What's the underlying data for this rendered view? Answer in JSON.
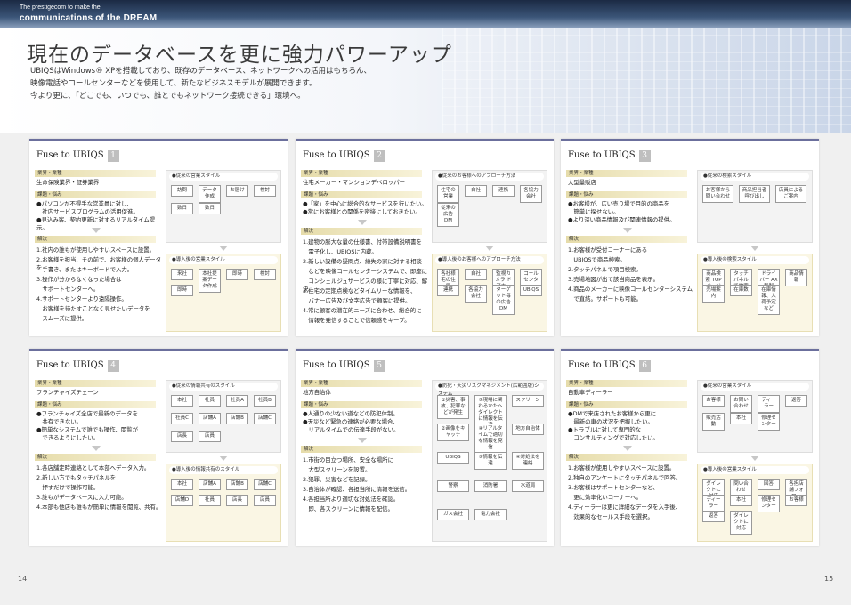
{
  "header": {
    "line1": "The prestigecom to make the",
    "line2": "communications of the DREAM"
  },
  "title": "現在のデータベースを更に強力パワーアップ",
  "lead": [
    "UBIQSはWindows® XPを搭載しており、既存のデータベース、ネットワークへの活用はもちろん、",
    "映像電話やコールセンターなどを使用して、新たなビジネスモデルが展開できます。",
    "今より更に、「どこでも、いつでも、誰とでもネットワーク接続できる」環境へ。"
  ],
  "common": {
    "fuse": "Fuse to UBIQS",
    "industry": "業界・業種",
    "issue": "課題・悩み",
    "solution": "解決"
  },
  "panels": [
    {
      "num": "1",
      "industry": "生命保険業界・証券業界",
      "issues": [
        "●パソコンが不得手な営業員に対し、",
        "　社内サービスプログラムの活用促進。",
        "●見込み客、契約更新に対するリアルタイム提示。"
      ],
      "solutions": [
        "1.社内の誰もが使用しやすいスペースに設置。",
        "2.お客様を担当、その前で、お客様の個人データを",
        "　手書き、またはキーボードで入力。",
        "3.操作が分からなくなった場合は",
        "　サポートセンターへ。",
        "4.サポートセンターより遠隔操作。",
        "　お客様を待たすことなく見せたいデータを",
        "　スムーズに提供。"
      ],
      "d1": {
        "title": "●従来の営業スタイル",
        "items": [
          "訪問",
          "データ作成",
          "お届け",
          "検討",
          "数日",
          "数日"
        ]
      },
      "d2": {
        "title": "●導入後の営業スタイル",
        "items": [
          "来社",
          "本社提案データ作成",
          "即時",
          "検討",
          "即時"
        ]
      }
    },
    {
      "num": "2",
      "industry": "住宅メーカー・マンションデベロッパー",
      "issues": [
        "●「家」を中心に総合的なサービスを行いたい。",
        "●常にお客様との関係を密接にしておきたい。"
      ],
      "solutions": [
        "1.建物の膨大な量の仕様書、付帯設備説明書を",
        "　電子化し、UBIQSに内蔵。",
        "2.新しい設備の疑問点、紛失の家に対する相談",
        "　などを映像コールセンターシステムで、即座に",
        "　コンシェルジュサービスの様に丁寧に対応、解決。",
        "3.住宅の定期点検などタイムリーな情報を、",
        "　バナー広告及び文字広告で顧客に提供。",
        "4.常に顧客の潜在的ニーズに合わせ、総合的に",
        "　情報を発信することで信頼感をキープ。"
      ],
      "d1": {
        "title": "●従来のお客様へのアプローチ方法",
        "items": [
          "住宅の営業",
          "自社",
          "連携",
          "各協力会社",
          "従来の広告 DM"
        ]
      },
      "d2": {
        "title": "●導入後のお客様へのアプローチ方法",
        "items": [
          "各社様宅の住居",
          "自社",
          "監視カメラ ドアホーン",
          "コールセンター",
          "連携",
          "各協力会社",
          "ターゲット毎の広告 DM",
          "UBIQS"
        ]
      }
    },
    {
      "num": "3",
      "industry": "大型量販店",
      "issues": [
        "●お客様が、広い売り場で目的の商品を",
        "　簡単に探せない。",
        "●より深い商品情報及び関連情報の提供。"
      ],
      "solutions": [
        "1.お客様が受付コーナーにある",
        "　UBIQSで商品検索。",
        "2.タッチパネルで項目検索。",
        "3.売場地図が出て該当商品を表示。",
        "4.商品のメーカーに映像コールセンターシステム",
        "　で直結。サポートも可能。"
      ],
      "d1": {
        "title": "●従来の検索スタイル",
        "items": [
          "お客様から問い合わせ",
          "商品担当者呼び出し",
          "店員による ご案内"
        ]
      },
      "d2": {
        "title": "●導入後の検索スタイル",
        "items": [
          "商品検索 TOPページ",
          "タッチパネルで検索",
          "ドライバー AX型製 TH-01",
          "商品情報",
          "売場案内",
          "在庫数",
          "在庫情報、入荷予定 など"
        ]
      }
    },
    {
      "num": "4",
      "industry": "フランチャイズチェーン",
      "issues": [
        "●フランチャイズ全店で最新のデータを",
        "　共有できない。",
        "●簡単なシステムで誰でも操作、閲覧が",
        "　できるようにしたい。"
      ],
      "solutions": [
        "1.各店舗定時連絡として本部へデータ入力。",
        "2.新しい方でもタッチパネルを",
        "　押すだけで操作可能。",
        "3.誰もがデータベースに入力可能。",
        "4.本部も他店も誰もが簡単に情報を閲覧、共有。"
      ],
      "d1": {
        "title": "●従来の情報共有のスタイル",
        "items": [
          "本社",
          "社員",
          "社員A",
          "社員B",
          "社員C",
          "店舗A",
          "店舗B",
          "店舗C",
          "店長",
          "店員"
        ]
      },
      "d2": {
        "title": "●導入後の情報共有のスタイル",
        "items": [
          "本社",
          "店舗A",
          "店舗B",
          "店舗C",
          "店舗D",
          "社員",
          "店長",
          "店員"
        ]
      }
    },
    {
      "num": "5",
      "industry": "地方自治体",
      "issues": [
        "●人通りの少ない道などの防犯体制。",
        "●天災など緊急の連絡が必要な場合、",
        "　リアルタイムでの伝達手段がない。"
      ],
      "solutions": [
        "1.市街の目立つ場所、安全な場所に",
        "　大型スクリーンを設置。",
        "2.犯罪、災害などを記録。",
        "3.自治体が確認、各担当所に情報を送信。",
        "4.各担当所より適切な対処法を確認。",
        "　即、各スクリーンに情報を配信。"
      ],
      "d1": {
        "title": "●防犯・天災リスクマネジメント(広範囲版)システム",
        "items": [
          "①災害、事故、犯罪などが発生",
          "⑤現場に関わるかたへダイレクトに情報を伝達",
          "スクリーン",
          "②画像をキャッチ",
          "④リアルタイムで適切な情報を発信",
          "地方自治体",
          "UBIQS",
          "③情報を伝達",
          "④対処法を連絡",
          "警察",
          "消防署",
          "水道局",
          "ガス会社",
          "電力会社"
        ]
      },
      "d2": {
        "title": "",
        "items": []
      }
    },
    {
      "num": "6",
      "industry": "自動車ディーラー",
      "issues": [
        "●DMで来店されたお客様から更に",
        "　最新の車の状況を把握したい。",
        "●トラブルに対して専門的な",
        "　コンサルティングで対応したい。"
      ],
      "solutions": [
        "1.お客様が使用しやすいスペースに設置。",
        "2.独自のアンケートにタッチパネルで回答。",
        "3.お客様はサポートセンターなど、",
        "　更に効率化いコーナーへ。",
        "4.ディーラーは更に詳細なデータを入手後、",
        "　効果的なセールス手段を選択。"
      ],
      "d1": {
        "title": "●従来の営業スタイル",
        "items": [
          "お客様",
          "お問い合わせ",
          "ディーラー",
          "返答",
          "販売活動",
          "本社",
          "修理センター"
        ]
      },
      "d2": {
        "title": "●導入後の営業スタイル",
        "items": [
          "ダイレクトに対応",
          "問い合わせ",
          "回答",
          "各担店舗フォロー",
          "ディーラー",
          "本社",
          "修理センター",
          "お客様",
          "返答",
          "ダイレクトに対応"
        ]
      }
    }
  ],
  "pages": {
    "left": "14",
    "right": "15"
  }
}
